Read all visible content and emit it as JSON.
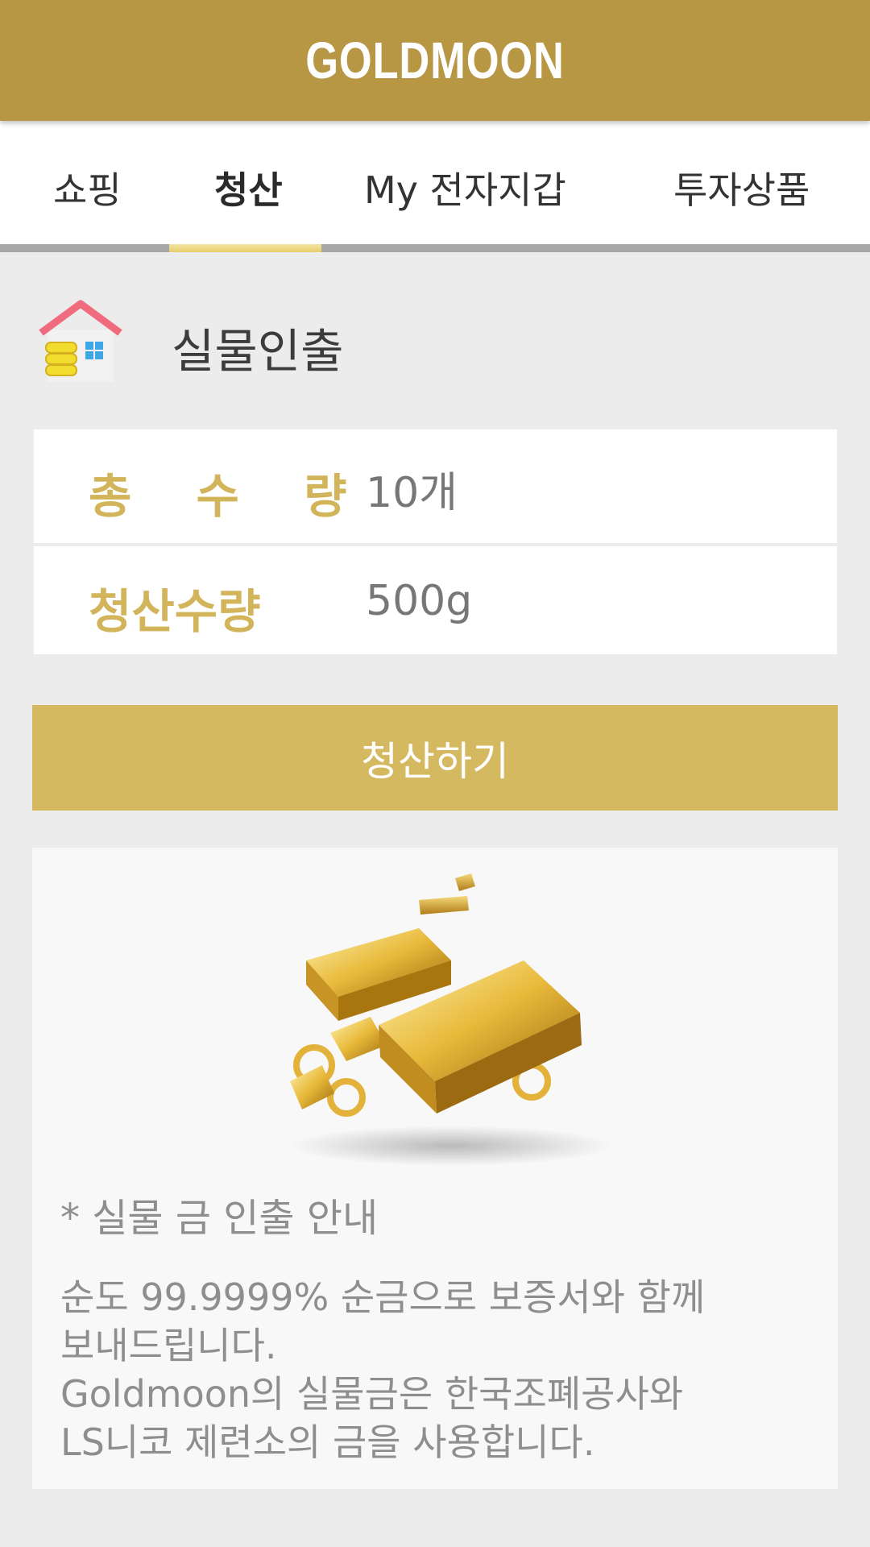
{
  "header": {
    "logo": "GOLDMOON"
  },
  "tabs": [
    {
      "label": "쇼핑",
      "active": false
    },
    {
      "label": "청산",
      "active": true
    },
    {
      "label": "My 전자지갑",
      "active": false
    },
    {
      "label": "투자상품",
      "active": false
    }
  ],
  "section": {
    "title": "실물인출",
    "icon": "house-gold-icon"
  },
  "info": [
    {
      "label": "총 수 량",
      "value": "10개"
    },
    {
      "label": "청산수량",
      "value": "500g"
    }
  ],
  "action": {
    "settle_label": "청산하기"
  },
  "notice": {
    "image": "gold-bars-icon",
    "heading": "* 실물 금 인출 안내",
    "lines": [
      "순도 99.9999% 순금으로 보증서와 함께",
      "보내드립니다.",
      "Goldmoon의 실물금은 한국조폐공사와",
      "LS니코 제련소의 금을 사용합니다."
    ]
  },
  "colors": {
    "header_bg": "#b89744",
    "accent_gold": "#d4b960",
    "label_gold": "#d2b45b",
    "page_bg": "#ececec"
  }
}
